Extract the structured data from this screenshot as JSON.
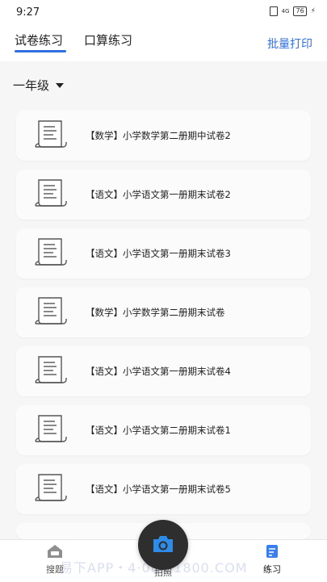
{
  "status_bar": {
    "time": "9:27",
    "battery": "76",
    "network": "4G"
  },
  "top_tabs": {
    "tabs": [
      {
        "label": "试卷练习"
      },
      {
        "label": "口算练习"
      }
    ],
    "batch_print": "批量打印"
  },
  "grade": {
    "selected": "一年级"
  },
  "papers": [
    {
      "title": "【数学】小学数学第二册期中试卷2"
    },
    {
      "title": "【语文】小学语文第一册期末试卷2"
    },
    {
      "title": "【语文】小学语文第一册期末试卷3"
    },
    {
      "title": "【数学】小学数学第二册期末试卷"
    },
    {
      "title": "【语文】小学语文第一册期末试卷4"
    },
    {
      "title": "【语文】小学语文第二册期末试卷1"
    },
    {
      "title": "【语文】小学语文第一册期末试卷5"
    }
  ],
  "bottom_nav": {
    "items": [
      {
        "label": "搜题"
      },
      {
        "label": "拍照"
      },
      {
        "label": "练习"
      }
    ]
  },
  "watermark": "易下APP・4·08·91800.COM",
  "colors": {
    "accent": "#2f6fe0",
    "camera_button": "#2e2e2e"
  }
}
